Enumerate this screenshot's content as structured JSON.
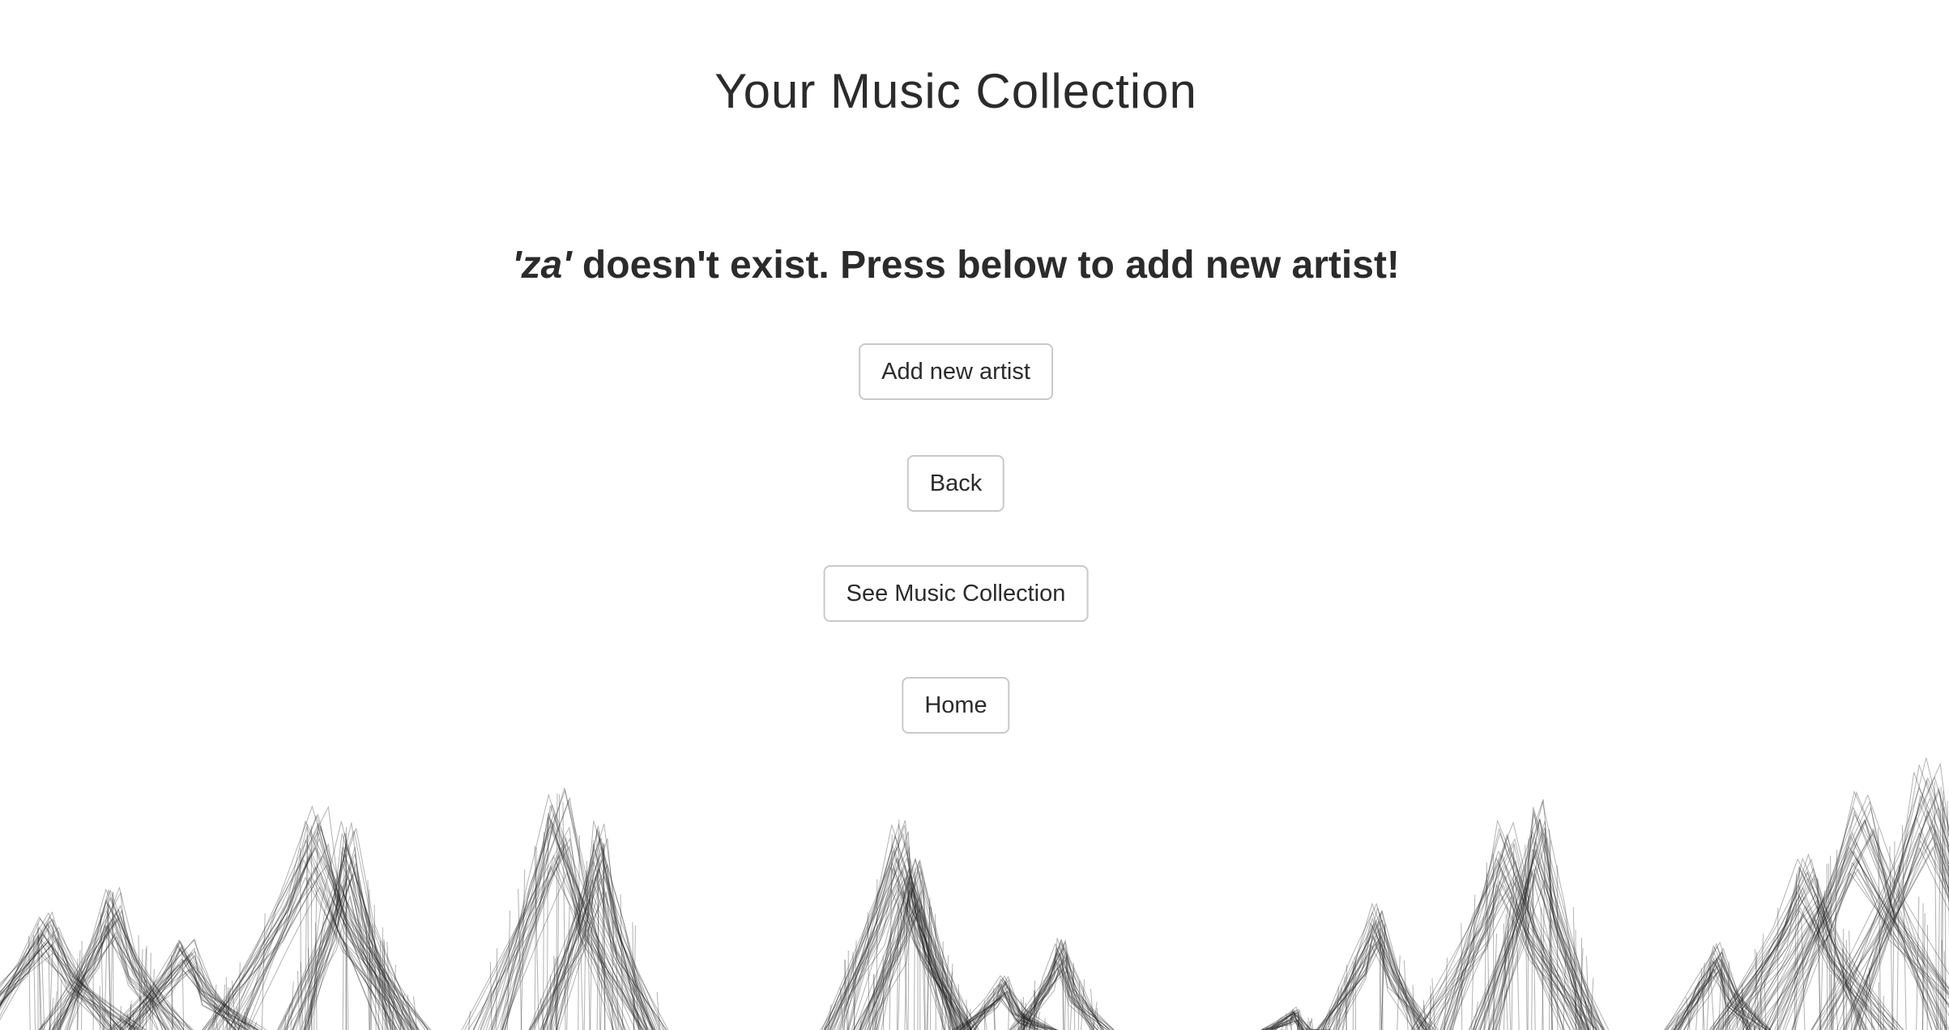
{
  "header": {
    "title": "Your Music Collection"
  },
  "message": {
    "search_term": "'za'",
    "text": " doesn't exist. Press below to add new artist!"
  },
  "buttons": {
    "add_new_artist": "Add new artist",
    "back": "Back",
    "see_music_collection": "See Music Collection",
    "home": "Home"
  }
}
